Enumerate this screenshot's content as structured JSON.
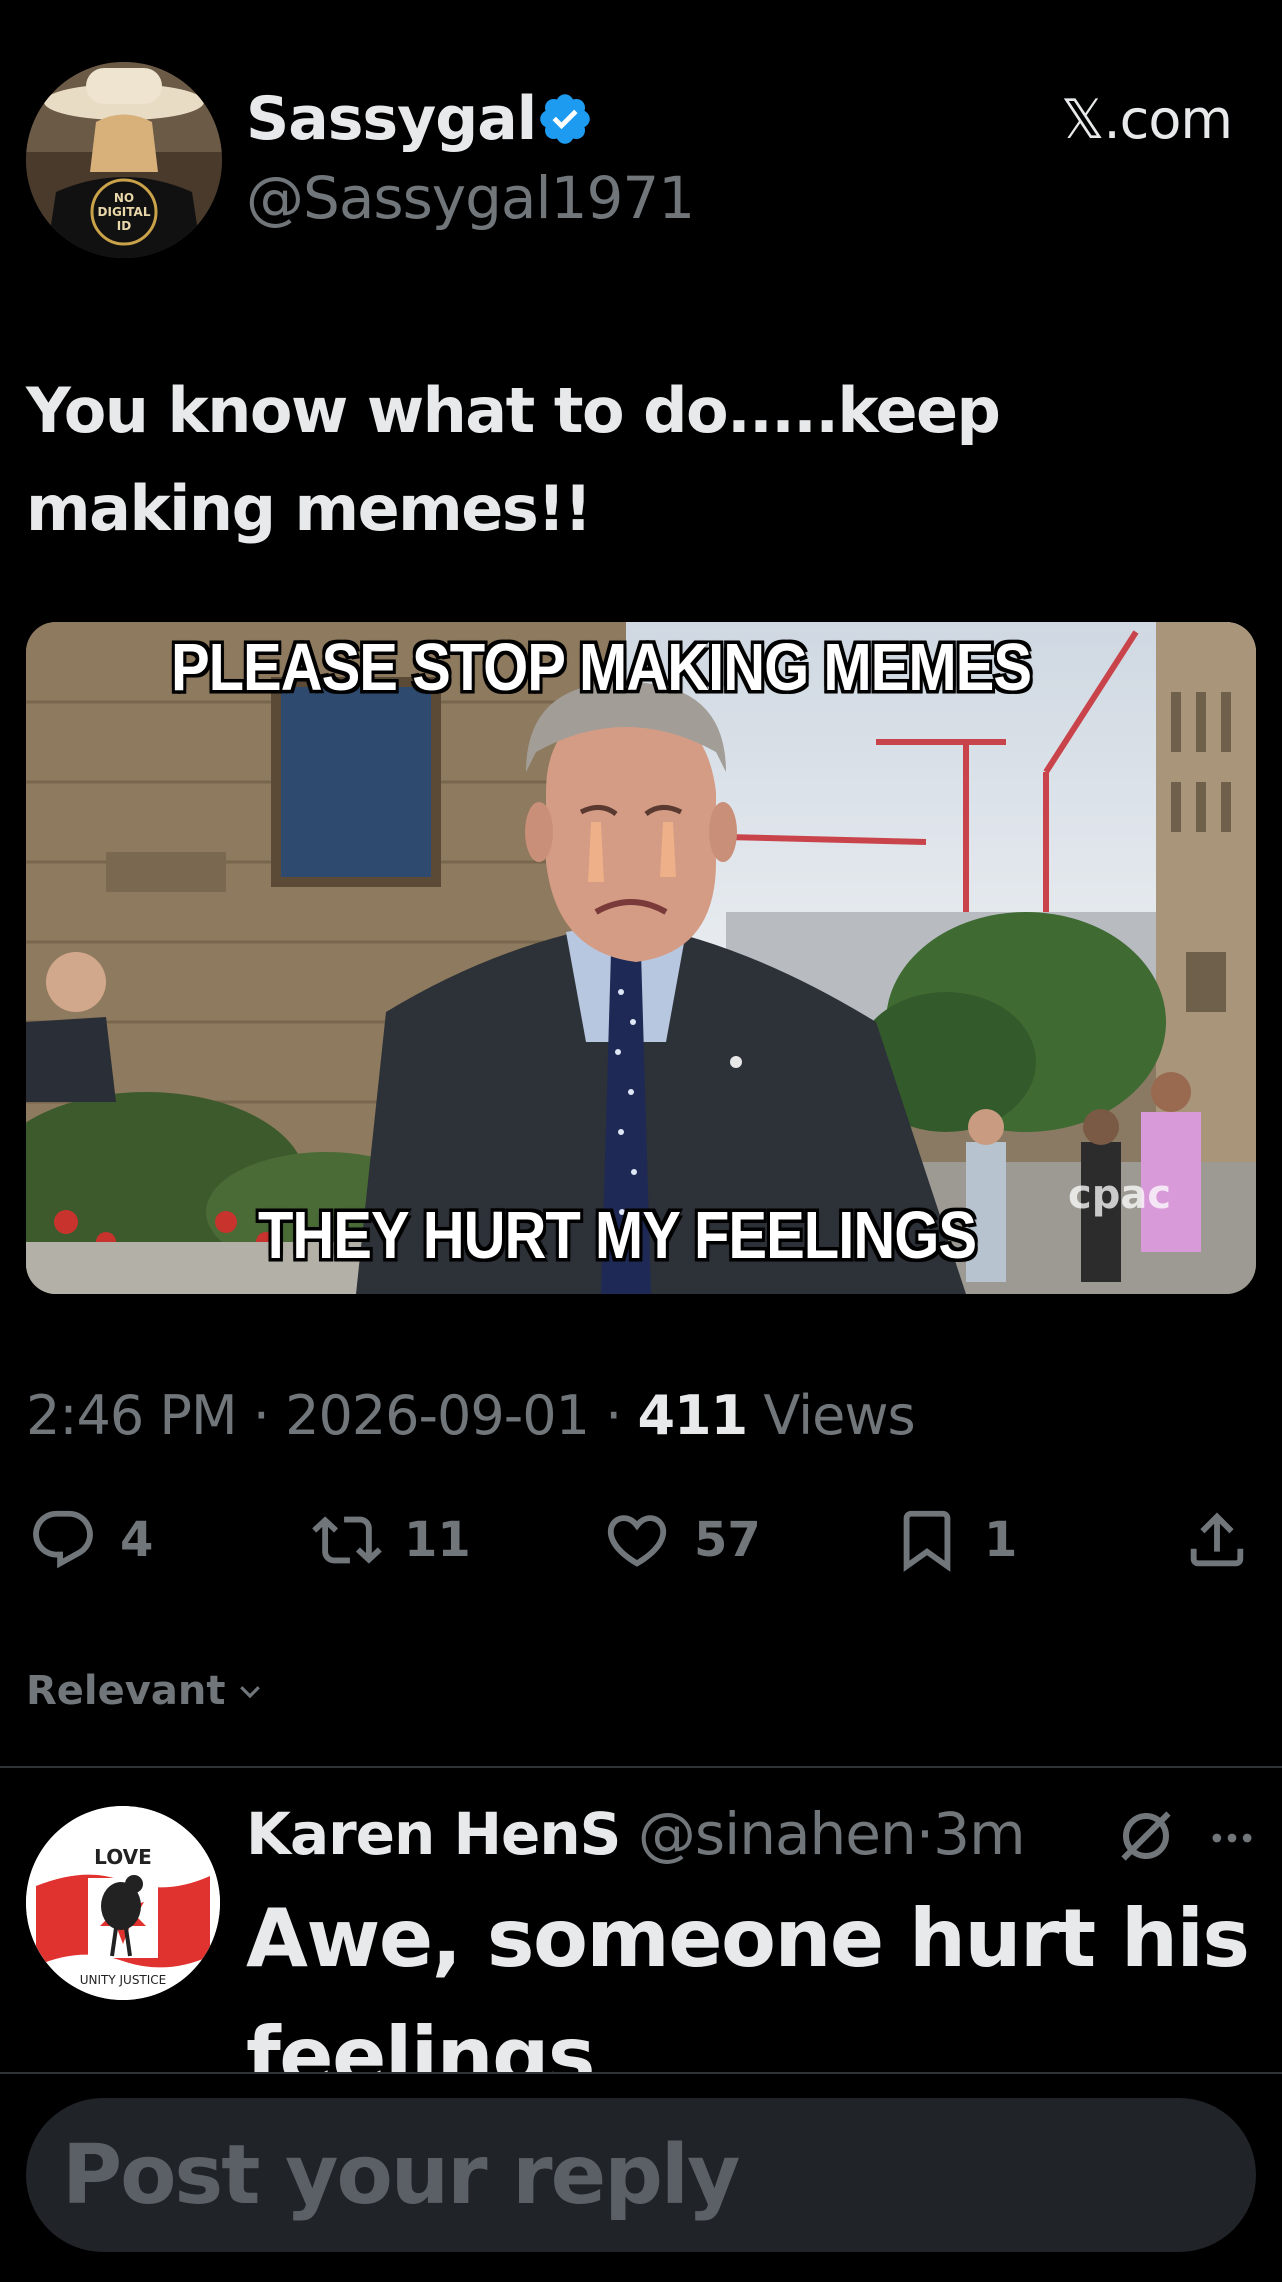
{
  "post": {
    "author_name": "Sassygal",
    "author_handle": "@Sassygal1971",
    "site_label": "𝕏.com",
    "verified_icon": "verified-badge-icon",
    "avatar_shirt_text": "NO DIGITAL ID",
    "text": "You know what to do.....keep making memes!!",
    "meme_top_text": "PLEASE STOP MAKING MEMES",
    "meme_bottom_text": "THEY HURT MY FEELINGS",
    "meme_watermark": "cpac",
    "time": "2:46 PM",
    "date": "2026-09-01",
    "views_count": "411",
    "views_label": "Views",
    "separator": "·"
  },
  "actions": {
    "replies": "4",
    "reposts": "11",
    "likes": "57",
    "bookmarks": "1"
  },
  "sort": {
    "label": "Relevant"
  },
  "reply": {
    "author_name": "Karen HenS",
    "author_handle": "@sinahen",
    "time": "3m",
    "text": "Awe, someone hurt his feelings",
    "avatar_text_top": "LOVE",
    "avatar_text_bottom": "UNITY JUSTICE"
  },
  "composer": {
    "placeholder": "Post your reply"
  },
  "colors": {
    "background": "#000000",
    "text_primary": "#e7e9ea",
    "text_secondary": "#71767b",
    "verified_blue": "#1d9bf0",
    "divider": "#2f3336"
  }
}
